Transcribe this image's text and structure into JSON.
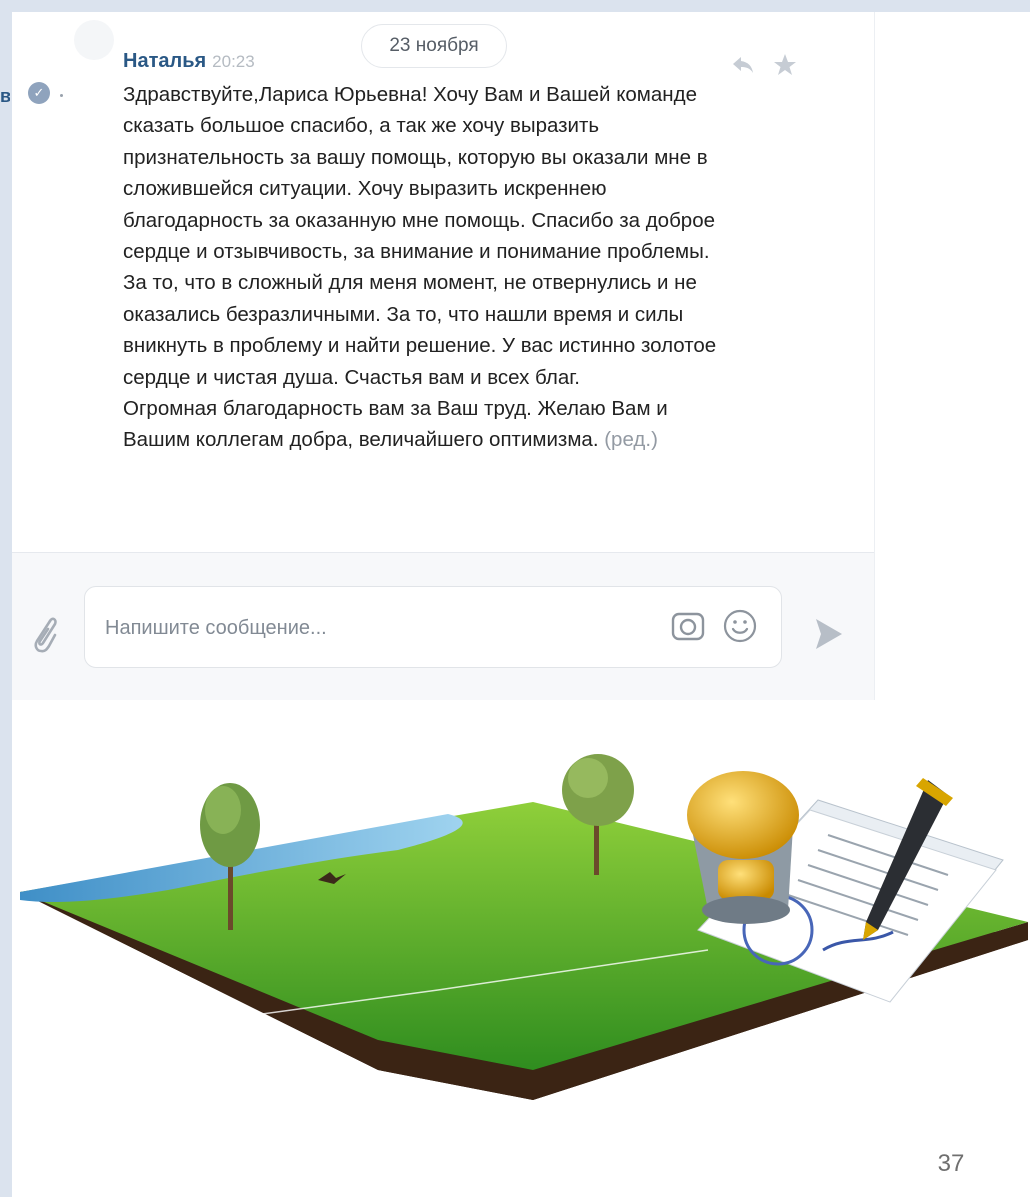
{
  "chat": {
    "date_chip": "23 ноября",
    "message": {
      "sender": "Наталья",
      "time": "20:23",
      "lines": [
        "Здравствуйте,Лариса Юрьевна! Хочу Вам и Вашей команде",
        "сказать большое спасибо, а так же хочу выразить",
        "признательность за вашу помощь, которую вы оказали мне в",
        "сложившейся ситуации. Хочу выразить искреннею",
        "благодарность за оказанную мне помощь. Спасибо за доброе",
        "сердце и отзывчивость, за внимание и понимание проблемы.",
        "За то, что в сложный для меня момент, не отвернулись и не",
        "оказались безразличными. За то, что нашли время и силы",
        "вникнуть в проблему и найти решение. У вас истинно золотое",
        "сердце и чистая душа. Счастья вам и всех благ.",
        "Огромная благодарность вам за Ваш труд. Желаю Вам и",
        "Вашим коллегам добра, величайшего оптимизма."
      ],
      "edited_mark": "(ред.)"
    },
    "icons": {
      "reply": "reply-icon",
      "favorite": "star-icon",
      "attach": "paperclip-icon",
      "camera": "camera-icon",
      "emoji": "smile-icon",
      "send": "send-icon",
      "verified": "checkmark-icon"
    },
    "composer": {
      "placeholder": "Напишите сообщение...",
      "value": ""
    },
    "side_cut_letter": "в"
  },
  "slide": {
    "page_number": "37"
  },
  "colors": {
    "accent": "#2a5885",
    "background_band": "#dbe3ee"
  }
}
